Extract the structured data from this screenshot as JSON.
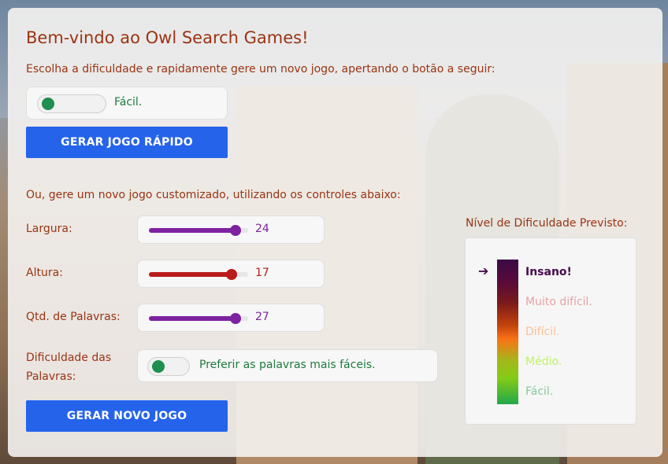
{
  "title": "Bem-vindo ao Owl Search Games!",
  "quick": {
    "description": "Escolha a dificuldade e rapidamente gere um novo jogo, apertando o botão a seguir:",
    "toggle_label": "Fácil.",
    "button_label": "GERAR JOGO RÁPIDO"
  },
  "custom": {
    "description": "Ou, gere um novo jogo customizado, utilizando os controles abaixo:",
    "width": {
      "label": "Largura:",
      "value": "24",
      "fraction": 0.87,
      "color": "#7e22a1"
    },
    "height": {
      "label": "Altura:",
      "value": "17",
      "fraction": 0.83,
      "color": "#b91c1c"
    },
    "words": {
      "label": "Qtd. de Palavras:",
      "value": "27",
      "fraction": 0.87,
      "color": "#7e22a1"
    },
    "word_difficulty": {
      "label": "Dificuldade das Palavras:",
      "toggle_label": "Preferir as palavras mais fáceis."
    },
    "button_label": "GERAR NOVO JOGO"
  },
  "difficulty_panel": {
    "title": "Nível de Dificuldade Previsto:",
    "arrow": "➔",
    "levels": [
      {
        "label": "Insano!",
        "color": "#4a0a4f",
        "active": true
      },
      {
        "label": "Muito difícil.",
        "color": "#e8a3a3",
        "active": false
      },
      {
        "label": "Difícil.",
        "color": "#fbbf94",
        "active": false
      },
      {
        "label": "Médio.",
        "color": "#bef264",
        "active": false
      },
      {
        "label": "Fácil.",
        "color": "#86c99a",
        "active": false
      }
    ]
  }
}
